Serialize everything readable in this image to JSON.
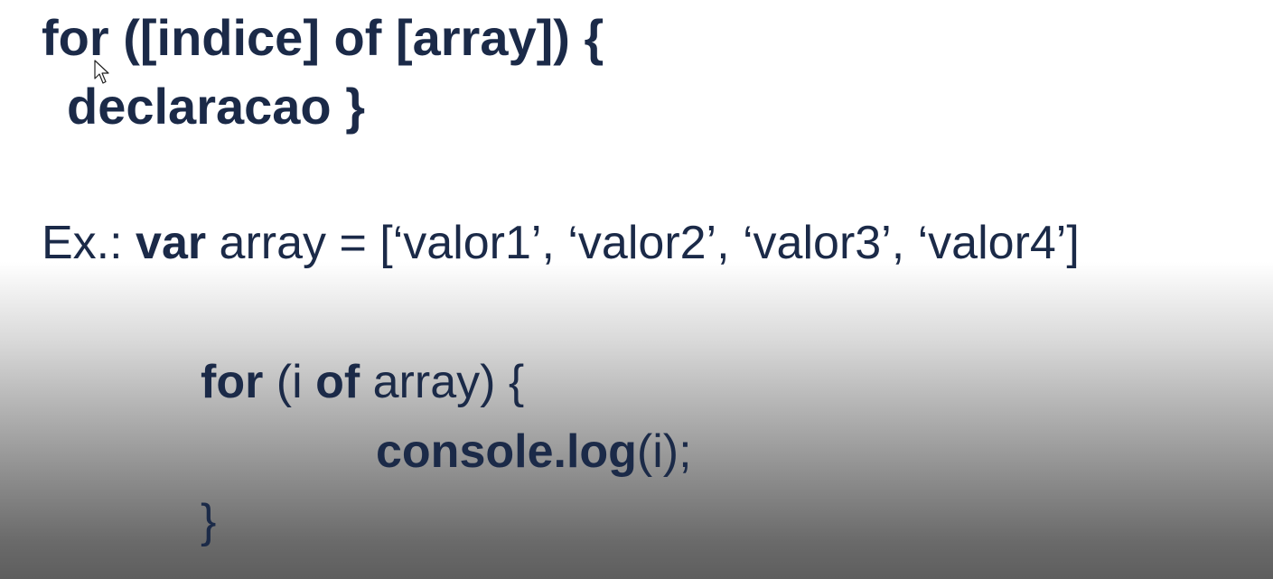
{
  "syntax": {
    "line1": "for ([indice] of [array]) {",
    "line2": "declaracao }"
  },
  "example": {
    "prefix": "Ex.: ",
    "keyword_var": "var",
    "declaration": " array = [‘valor1’, ‘valor2’, ‘valor3’, ‘valor4’]"
  },
  "code": {
    "for_keyword": "for",
    "paren_open_i": " (i ",
    "of_keyword": "of",
    "array_brace": " array) {",
    "console_log": "console.log",
    "call_args": "(i);",
    "closing_brace": "}"
  },
  "icons": {
    "cursor": "mouse-pointer-icon"
  },
  "colors": {
    "text": "#1b2a48",
    "background_top": "#ffffff",
    "background_bottom": "#5e5e5e"
  }
}
